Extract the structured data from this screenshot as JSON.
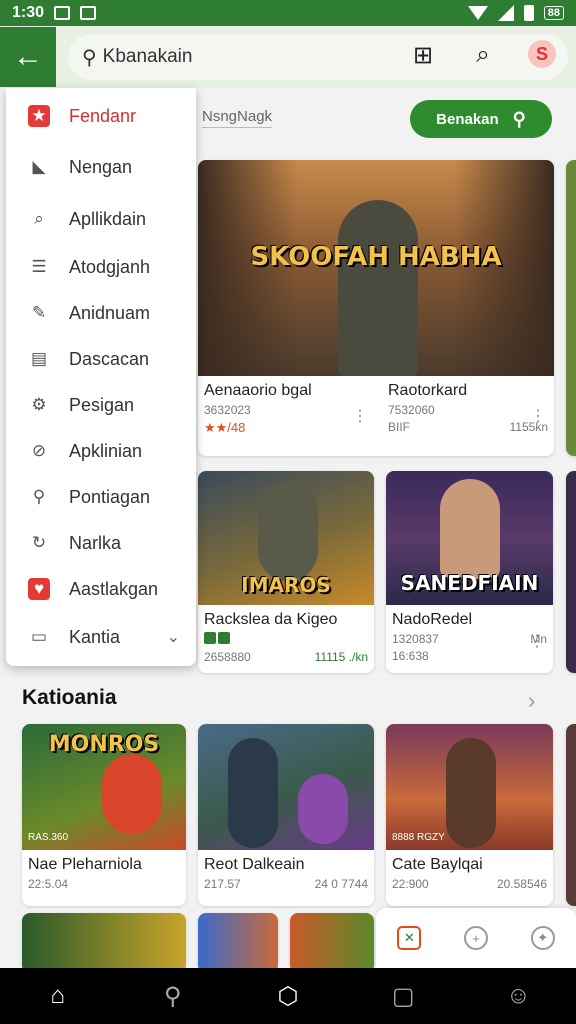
{
  "status_bar": {
    "time": "1:30",
    "label": "88"
  },
  "app_bar": {
    "search_text": "Kbanakain"
  },
  "filter": {
    "field_text": "NsngNagk",
    "button_label": "Benakan"
  },
  "drawer": {
    "items": [
      {
        "label": "Fendanr",
        "icon": "star-badge-icon",
        "glyph": "★",
        "active": true
      },
      {
        "label": "Nengan",
        "icon": "flag-icon",
        "glyph": "◣"
      },
      {
        "label": "Apllikdain",
        "icon": "apps-search-icon",
        "glyph": "⌕"
      },
      {
        "label": "Atodgjanh",
        "icon": "list-icon",
        "glyph": "☰"
      },
      {
        "label": "Anidnuam",
        "icon": "brush-icon",
        "glyph": "✎"
      },
      {
        "label": "Dascacan",
        "icon": "document-icon",
        "glyph": "▤"
      },
      {
        "label": "Pesigan",
        "icon": "settings-icon",
        "glyph": "⚙"
      },
      {
        "label": "Apklinian",
        "icon": "circle-slash-icon",
        "glyph": "⊘"
      },
      {
        "label": "Pontiagan",
        "icon": "search-person-icon",
        "glyph": "⚲"
      },
      {
        "label": "Narlka",
        "icon": "refresh-icon",
        "glyph": "↻"
      },
      {
        "label": "Aastlakgan",
        "icon": "heart-badge-icon",
        "glyph": "♥"
      },
      {
        "label": "Kantia",
        "icon": "folder-icon",
        "glyph": "▭"
      }
    ]
  },
  "featured": [
    {
      "art_title": "SKOOFAH HABHA",
      "title": "Aenaaorio bgal",
      "sub": "3632023",
      "rating": "★★/48"
    },
    {
      "title": "Raotorkard",
      "sub": "7532060",
      "meta_left": "BIIF",
      "meta_right": "1155kn"
    }
  ],
  "grid": [
    {
      "art_title": "IMAROS",
      "title": "Rackslea da Kigeo",
      "sub": "2658880",
      "value": "11115 ./kn"
    },
    {
      "art_title": "SANEDFIAIN",
      "title": "NadoRedel",
      "sub_badge": "Mn",
      "sub": "1320837",
      "meta": "16:638"
    }
  ],
  "section": {
    "title": "Katioania"
  },
  "row": [
    {
      "art_title": "MONROS",
      "caption": "RAS.360",
      "title": "Nae Pleharniola",
      "sub": "22:5.04"
    },
    {
      "title": "Reot Dalkeain",
      "sub": "217.57",
      "value": "24 0 7744"
    },
    {
      "caption": "8888 RGZY",
      "title": "Cate Baylqai",
      "sub": "22:900",
      "value": "20.58546"
    }
  ],
  "colors": {
    "accent": "#2e7d32",
    "active_red": "#d32f2f",
    "rating": "#e64a19"
  }
}
